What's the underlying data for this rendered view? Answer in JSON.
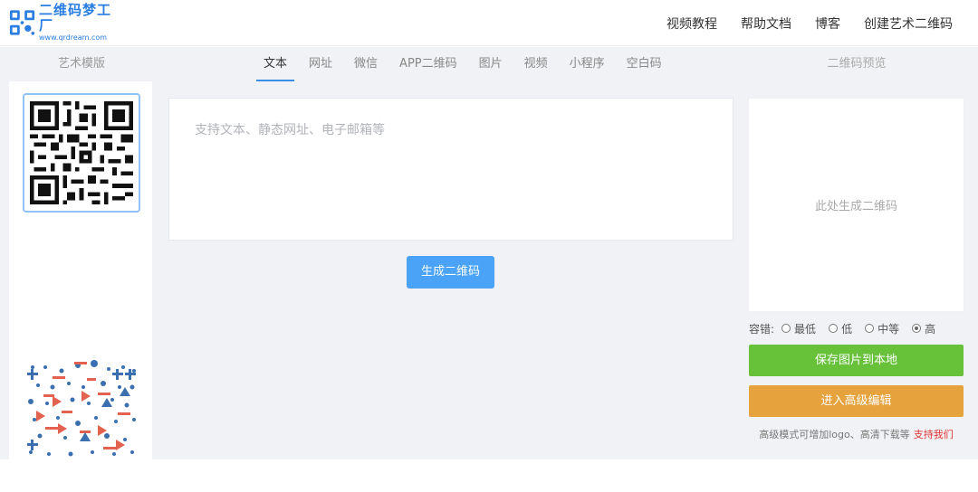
{
  "header": {
    "logo_title": "二维码梦工厂",
    "logo_url": "www.qrdream.com",
    "nav": [
      "视频教程",
      "帮助文档",
      "博客",
      "创建艺术二维码"
    ]
  },
  "tabbar": {
    "art_template_label": "艺术模版",
    "tabs": [
      "文本",
      "网址",
      "微信",
      "APP二维码",
      "图片",
      "视频",
      "小程序",
      "空白码"
    ],
    "active_tab": "文本",
    "preview_label": "二维码预览"
  },
  "editor": {
    "placeholder": "支持文本、静态网址、电子邮箱等",
    "value": "",
    "generate_label": "生成二维码"
  },
  "preview": {
    "placeholder_text": "此处生成二维码",
    "error_correction_label": "容错:",
    "error_levels": [
      "最低",
      "低",
      "中等",
      "高"
    ],
    "selected_level": "高",
    "save_label": "保存图片到本地",
    "advanced_label": "进入高级编辑",
    "hint_text": "高级模式可增加logo、高清下载等",
    "hint_link": "支持我们"
  },
  "colors": {
    "accent": "#3a8ee6",
    "generate_button": "#4aa3f7",
    "save_button": "#67c23a",
    "advanced_button": "#e6a23c",
    "link_red": "#e0302f"
  },
  "icons": {
    "logo": "qr-logo-icon",
    "sample_template": "qr-code-icon",
    "art_template": "art-qr-code-icon"
  }
}
